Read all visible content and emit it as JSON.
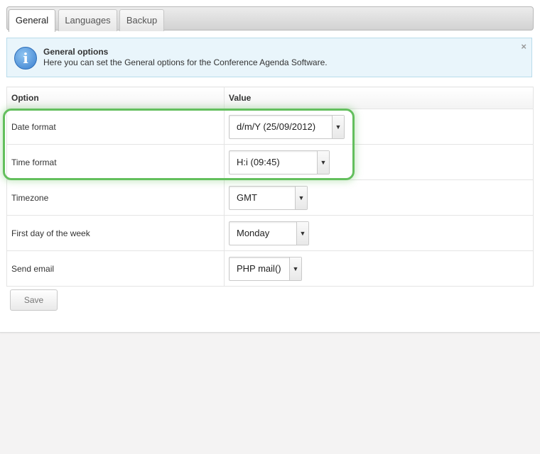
{
  "tabs": [
    {
      "label": "General",
      "active": true
    },
    {
      "label": "Languages",
      "active": false
    },
    {
      "label": "Backup",
      "active": false
    }
  ],
  "info": {
    "icon": "info-icon",
    "title": "General options",
    "text": "Here you can set the General options for the Conference Agenda Software.",
    "close": "×"
  },
  "table": {
    "headers": {
      "option": "Option",
      "value": "Value"
    },
    "rows": [
      {
        "label": "Date format",
        "value": "d/m/Y (25/09/2012)"
      },
      {
        "label": "Time format",
        "value": "H:i (09:45)"
      },
      {
        "label": "Timezone",
        "value": "GMT"
      },
      {
        "label": "First day of the week",
        "value": "Monday"
      },
      {
        "label": "Send email",
        "value": "PHP mail()"
      }
    ]
  },
  "save_label": "Save",
  "colors": {
    "highlight": "#63bf5d",
    "info_bg": "#e9f5fb",
    "info_border": "#b9dceb"
  }
}
